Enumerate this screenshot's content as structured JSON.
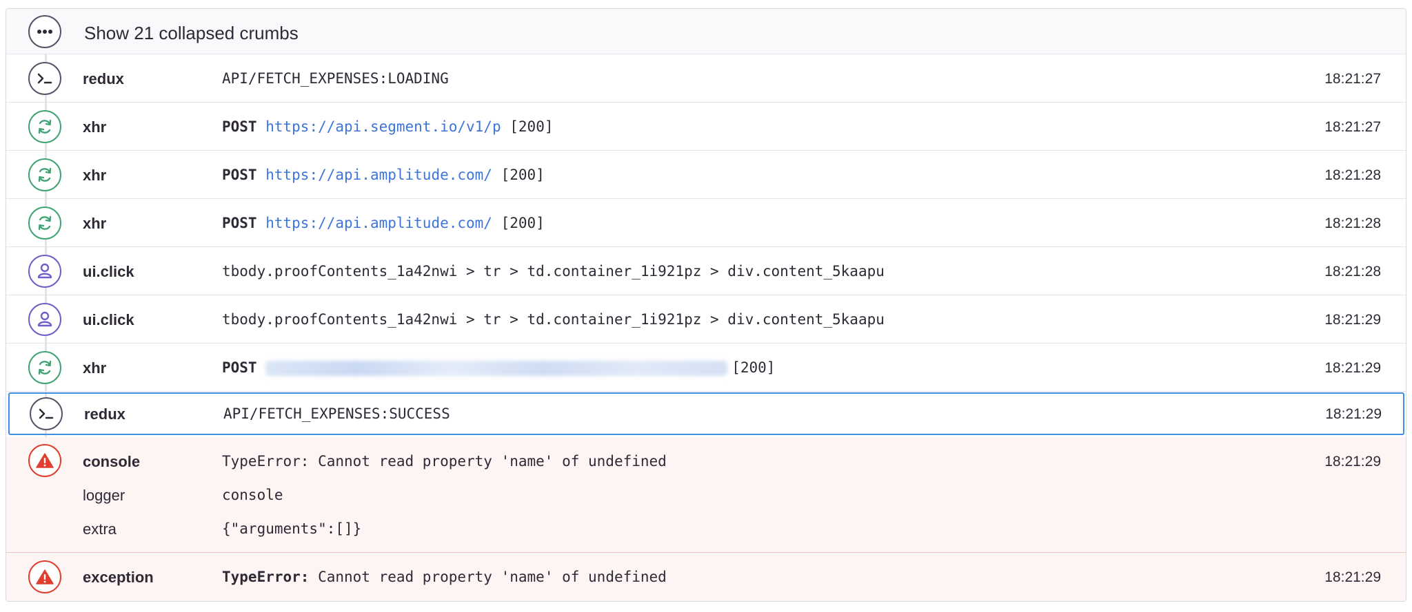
{
  "collapsed": {
    "label": "Show 21 collapsed crumbs",
    "icon": "ellipsis-icon"
  },
  "crumbs": [
    {
      "category": "redux",
      "icon": "terminal-icon",
      "color": "#5b5168",
      "message": "API/FETCH_EXPENSES:LOADING",
      "time": "18:21:27"
    },
    {
      "category": "xhr",
      "icon": "refresh-icon",
      "color": "#3fa372",
      "method": "POST",
      "url": "https://api.segment.io/v1/p",
      "status": "[200]",
      "time": "18:21:27"
    },
    {
      "category": "xhr",
      "icon": "refresh-icon",
      "color": "#3fa372",
      "method": "POST",
      "url": "https://api.amplitude.com/",
      "status": "[200]",
      "time": "18:21:28"
    },
    {
      "category": "xhr",
      "icon": "refresh-icon",
      "color": "#3fa372",
      "method": "POST",
      "url": "https://api.amplitude.com/",
      "status": "[200]",
      "time": "18:21:28"
    },
    {
      "category": "ui.click",
      "icon": "user-icon",
      "color": "#6c5fc7",
      "message": "tbody.proofContents_1a42nwi > tr > td.container_1i921pz > div.content_5kaapu",
      "time": "18:21:28"
    },
    {
      "category": "ui.click",
      "icon": "user-icon",
      "color": "#6c5fc7",
      "message": "tbody.proofContents_1a42nwi > tr > td.container_1i921pz > div.content_5kaapu",
      "time": "18:21:29"
    },
    {
      "category": "xhr",
      "icon": "refresh-icon",
      "color": "#3fa372",
      "method": "POST",
      "status": "[200]",
      "time": "18:21:29"
    },
    {
      "category": "redux",
      "icon": "terminal-icon",
      "color": "#5b5168",
      "message": "API/FETCH_EXPENSES:SUCCESS",
      "time": "18:21:29",
      "selected": true
    },
    {
      "category": "console",
      "icon": "warning-icon",
      "color": "#e03e2f",
      "message": "TypeError: Cannot read property 'name' of undefined",
      "time": "18:21:29",
      "extra_rows": [
        {
          "key": "logger",
          "value": "console"
        },
        {
          "key": "extra",
          "value": "{\"arguments\":[]}"
        }
      ]
    },
    {
      "category": "exception",
      "icon": "warning-icon",
      "color": "#e03e2f",
      "exc_type": "TypeError:",
      "message": "Cannot read property 'name' of undefined",
      "time": "18:21:29"
    }
  ]
}
